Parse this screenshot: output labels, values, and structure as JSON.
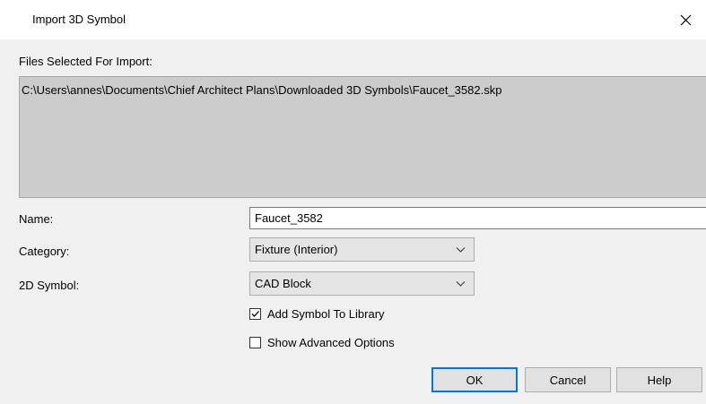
{
  "window": {
    "title": "Import 3D Symbol",
    "close_label": "✕"
  },
  "files": {
    "label": "Files Selected For Import:",
    "path": "C:\\Users\\annes\\Documents\\Chief Architect Plans\\Downloaded 3D Symbols\\Faucet_3582.skp"
  },
  "name": {
    "label": "Name:",
    "value": "Faucet_3582"
  },
  "category": {
    "label": "Category:",
    "value": "Fixture (Interior)"
  },
  "symbol2d": {
    "label": "2D Symbol:",
    "value": "CAD Block"
  },
  "options": {
    "add_to_library": {
      "label": "Add Symbol To Library",
      "checked": true
    },
    "show_advanced": {
      "label": "Show Advanced Options",
      "checked": false
    }
  },
  "buttons": {
    "ok": "OK",
    "cancel": "Cancel",
    "help": "Help"
  },
  "colors": {
    "client_bg": "#f0f0f0",
    "files_box_bg": "#cccccc",
    "default_button_border": "#0078d7"
  }
}
